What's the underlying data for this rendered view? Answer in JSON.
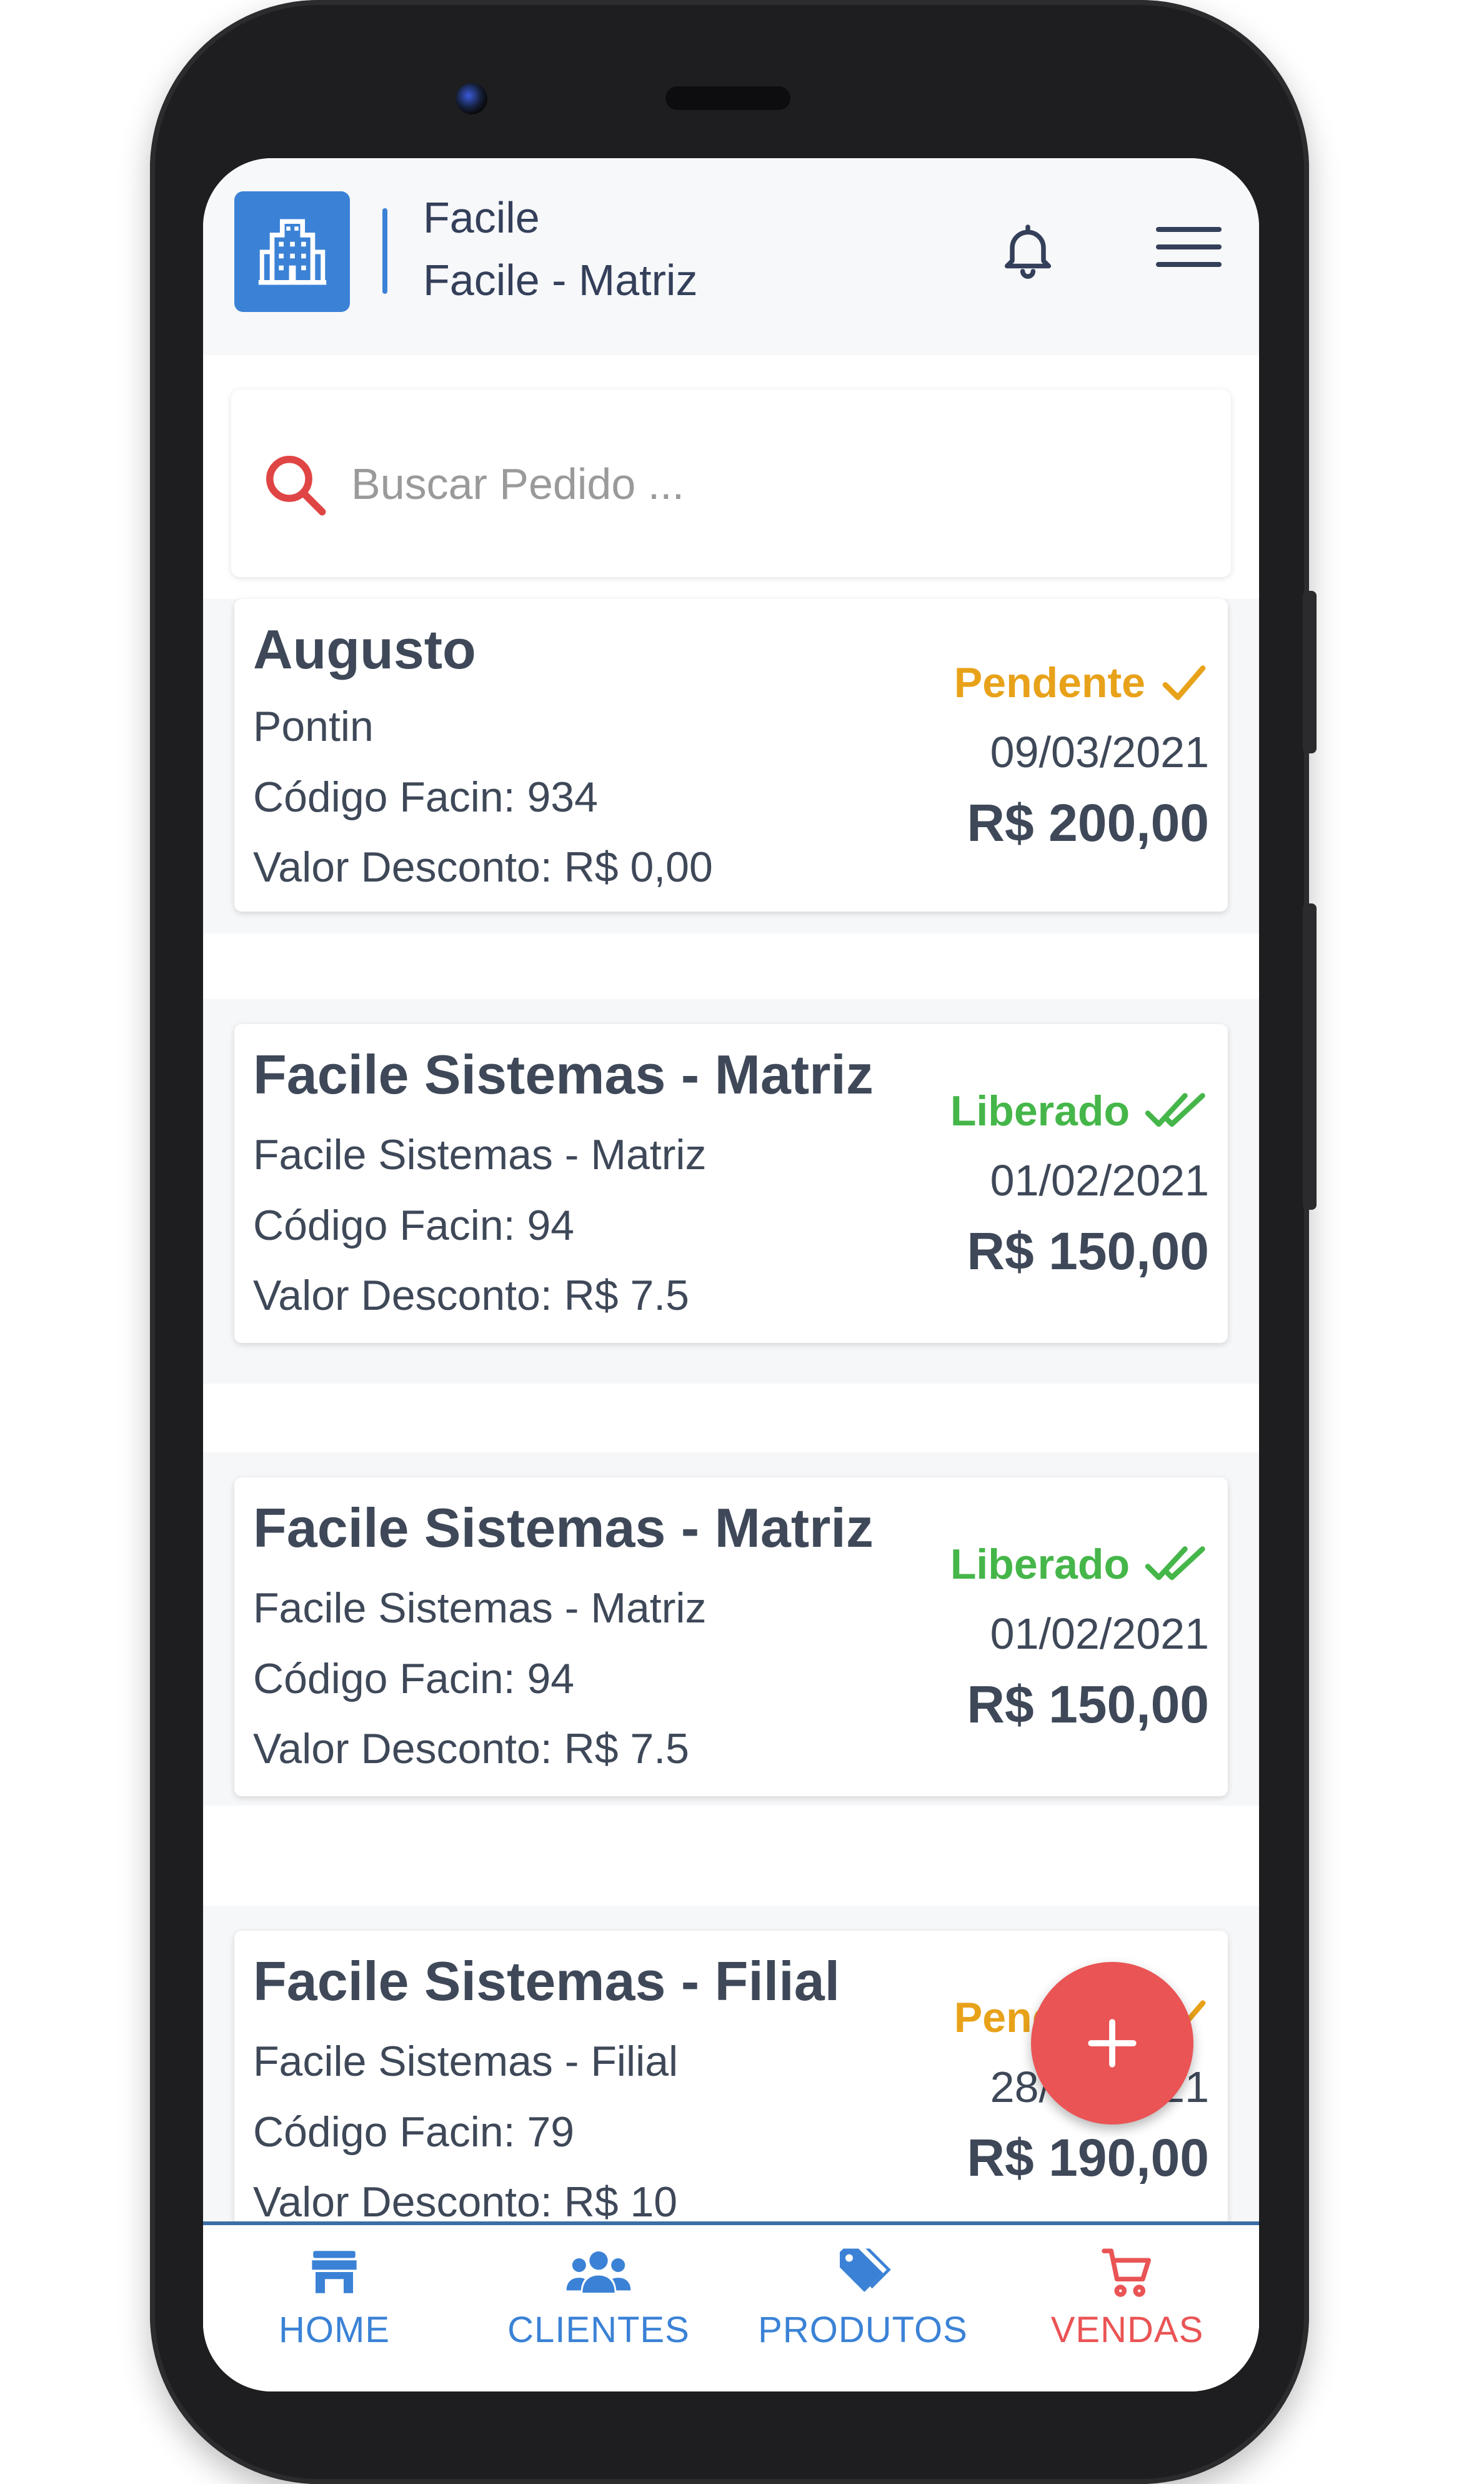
{
  "header": {
    "company": "Facile",
    "branch": "Facile - Matriz"
  },
  "search": {
    "placeholder": "Buscar Pedido ..."
  },
  "colors": {
    "accent": "#3b82d6",
    "pending": "#e8a21a",
    "released": "#45b649",
    "danger": "#ea5455"
  },
  "orders": [
    {
      "name": "Augusto",
      "subtitle": "Pontin",
      "code": "Código Facin: 934",
      "discount": "Valor Desconto: R$ 0,00",
      "status": "Pendente",
      "status_kind": "pending",
      "date": "09/03/2021",
      "total": "R$ 200,00"
    },
    {
      "name": "Facile Sistemas - Matriz",
      "subtitle": "Facile Sistemas - Matriz",
      "code": "Código Facin: 94",
      "discount": "Valor Desconto: R$ 7.5",
      "status": "Liberado",
      "status_kind": "released",
      "date": "01/02/2021",
      "total": "R$ 150,00"
    },
    {
      "name": "Facile Sistemas - Matriz",
      "subtitle": "Facile Sistemas - Matriz",
      "code": "Código Facin: 94",
      "discount": "Valor Desconto: R$ 7.5",
      "status": "Liberado",
      "status_kind": "released",
      "date": "01/02/2021",
      "total": "R$ 150,00"
    },
    {
      "name": "Facile Sistemas - Filial",
      "subtitle": "Facile Sistemas - Filial",
      "code": "Código Facin: 79",
      "discount": "Valor Desconto: R$ 10",
      "status": "Pendente",
      "status_kind": "pending",
      "date": "28/01/2021",
      "total": "R$ 190,00"
    }
  ],
  "nav": [
    {
      "label": "HOME",
      "icon": "store-icon"
    },
    {
      "label": "CLIENTES",
      "icon": "users-icon"
    },
    {
      "label": "PRODUTOS",
      "icon": "tag-icon"
    },
    {
      "label": "VENDAS",
      "icon": "cart-icon"
    }
  ]
}
